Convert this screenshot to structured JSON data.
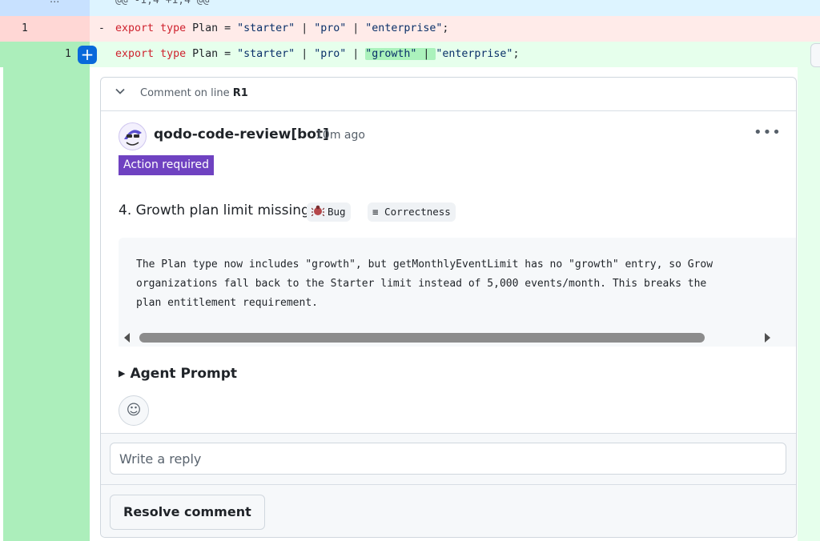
{
  "hunk": {
    "dots": "...",
    "header": "@@ -1,4 +1,4 @@"
  },
  "deleted_line": {
    "line_number": "1",
    "sign": "-",
    "code": {
      "keyword1": "export",
      "keyword2": "type",
      "ident": " Plan = ",
      "s1": "\"starter\"",
      "s2": "\"pro\"",
      "s3": "\"enterprise\"",
      "end": ";"
    }
  },
  "added_line": {
    "line_number": "1",
    "plus_button": "+",
    "code": {
      "keyword1": "export",
      "keyword2": "type",
      "ident": " Plan = ",
      "s1": "\"starter\"",
      "s2": "\"pro\"",
      "s_new": "\"growth\"",
      "s3": "\"enterprise\"",
      "end": ";"
    }
  },
  "comment": {
    "header_prefix": "Comment on line ",
    "header_line": "R1",
    "author": "qodo-code-review[bot]",
    "time": "10m ago",
    "menu": "•••",
    "badge": "Action required",
    "finding_title": "4. Growth plan limit missing",
    "tag_bug": "Bug",
    "tag_correctness": "≡ Correctness",
    "body_lines": [
      "The Plan type now includes \"growth\", but getMonthlyEventLimit has no \"growth\" entry, so Grow",
      "organizations fall back to the Starter limit instead of 5,000 events/month. This breaks the",
      "plan entitlement requirement."
    ],
    "agent_prompt": "Agent Prompt",
    "emoji": "☺",
    "reply_placeholder": "Write a reply",
    "resolve_label": "Resolve comment"
  },
  "colors": {
    "accent": "#0969da",
    "badge": "#6f42c1",
    "added_bg": "#e6ffec",
    "deleted_bg": "#ffebe9"
  }
}
